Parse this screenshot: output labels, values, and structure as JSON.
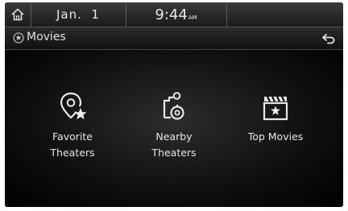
{
  "status_bar": {
    "date": "Jan.  1",
    "time": "9:44",
    "time_suffix": "AM"
  },
  "header": {
    "title": "Movies",
    "icon": "movies-icon",
    "back_icon": "back-arrow-icon"
  },
  "menu": [
    {
      "line1": "Favorite",
      "line2": "Theaters",
      "icon": "favorite-theaters-icon"
    },
    {
      "line1": "Nearby",
      "line2": "Theaters",
      "icon": "nearby-theaters-icon"
    },
    {
      "line1": "Top Movies",
      "line2": "",
      "icon": "top-movies-icon"
    }
  ]
}
